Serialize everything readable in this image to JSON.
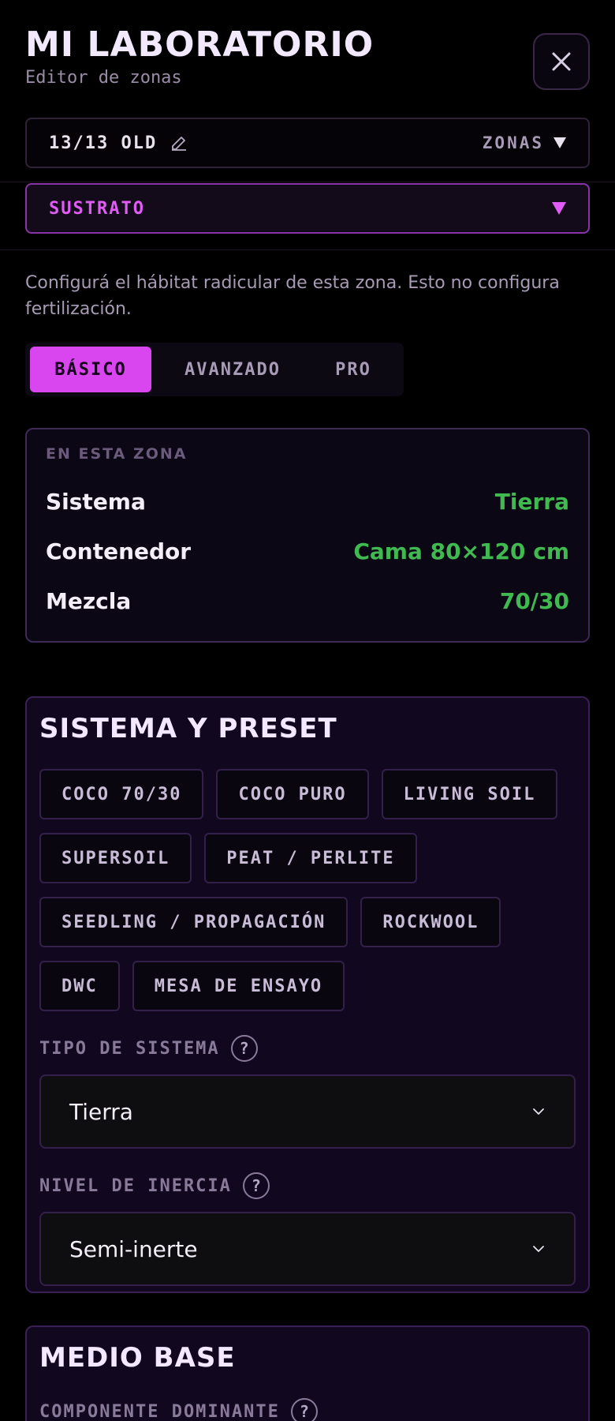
{
  "header": {
    "title": "MI LABORATORIO",
    "subtitle": "Editor de zonas"
  },
  "icons": {
    "close": "close-icon",
    "edit": "pencil-icon",
    "dropdown": "triangle-down-icon",
    "help": "question-icon",
    "chevron": "chevron-down-icon"
  },
  "zone_bar": {
    "zone_name": "13/13 OLD",
    "zones_label": "ZONAS"
  },
  "section_select": {
    "value": "SUSTRATO"
  },
  "description": "Configurá el hábitat radicular de esta zona. Esto no configura fertilización.",
  "tabs": [
    {
      "label": "BÁSICO",
      "active": true
    },
    {
      "label": "AVANZADO",
      "active": false
    },
    {
      "label": "PRO",
      "active": false
    }
  ],
  "summary": {
    "caption": "EN ESTA ZONA",
    "rows": [
      {
        "key": "Sistema",
        "value": "Tierra"
      },
      {
        "key": "Contenedor",
        "value": "Cama 80×120 cm"
      },
      {
        "key": "Mezcla",
        "value": "70/30"
      }
    ]
  },
  "system_card": {
    "title": "SISTEMA Y PRESET",
    "presets": [
      "COCO 70/30",
      "COCO PURO",
      "LIVING SOIL",
      "SUPERSOIL",
      "PEAT / PERLITE",
      "SEEDLING / PROPAGACIÓN",
      "ROCKWOOL",
      "DWC",
      "MESA DE ENSAYO"
    ],
    "system_type": {
      "label": "TIPO DE SISTEMA",
      "value": "Tierra"
    },
    "inertia": {
      "label": "NIVEL DE INERCIA",
      "value": "Semi-inerte"
    }
  },
  "base_card": {
    "title": "MEDIO BASE",
    "dominant": {
      "label": "COMPONENTE DOMINANTE"
    }
  },
  "colors": {
    "accent": "#d946ef",
    "value_green": "#3fb950",
    "background": "#000000"
  }
}
